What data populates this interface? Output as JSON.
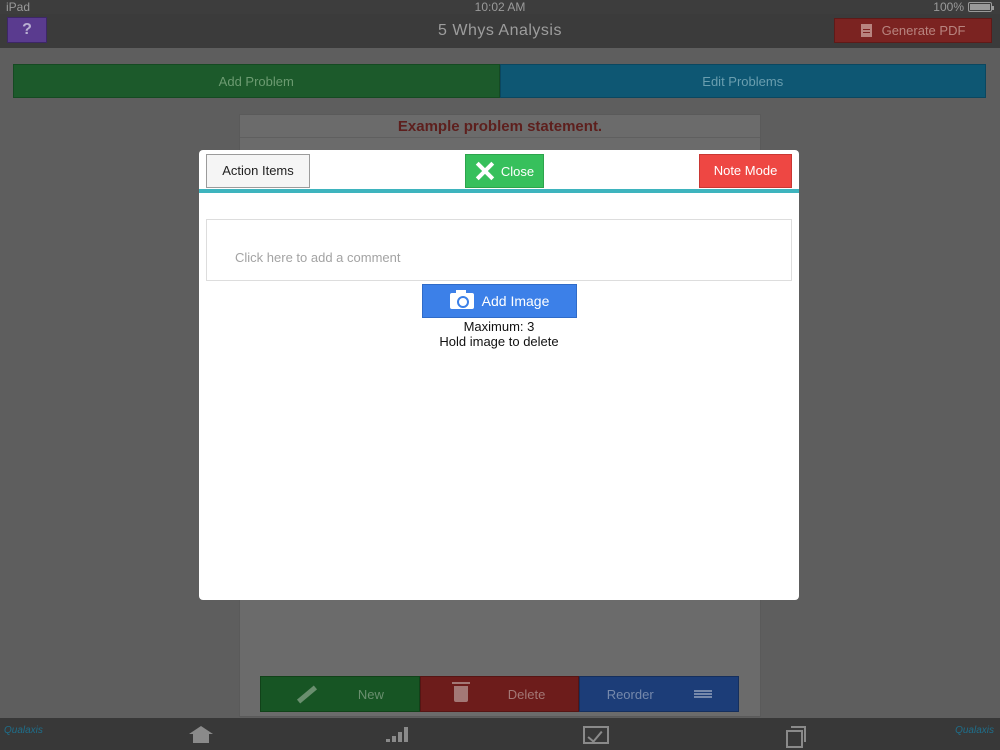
{
  "status_bar": {
    "device": "iPad",
    "time": "10:02 AM",
    "battery": "100%"
  },
  "nav": {
    "help": "?",
    "title": "5 Whys Analysis",
    "pdf_label": "Generate PDF"
  },
  "tabs": [
    {
      "label": "Add Problem"
    },
    {
      "label": "Edit Problems"
    }
  ],
  "background_card": {
    "title": "Example problem statement."
  },
  "bottom_actions": {
    "new": "New",
    "delete": "Delete",
    "reorder": "Reorder"
  },
  "tab_bar": {
    "logo_left": "Qualaxis",
    "logo_right": "Qualaxis"
  },
  "modal": {
    "action_items": "Action Items",
    "close": "Close",
    "note_mode": "Note Mode",
    "comment_placeholder": "Click here to add a comment",
    "add_image": "Add Image",
    "maximum": "Maximum: 3",
    "hold_hint": "Hold image to delete"
  },
  "colors": {
    "accent_line": "#3eb4be",
    "close_green": "#37c05c",
    "note_red": "#ee4743",
    "add_image_blue": "#3c80e8"
  }
}
